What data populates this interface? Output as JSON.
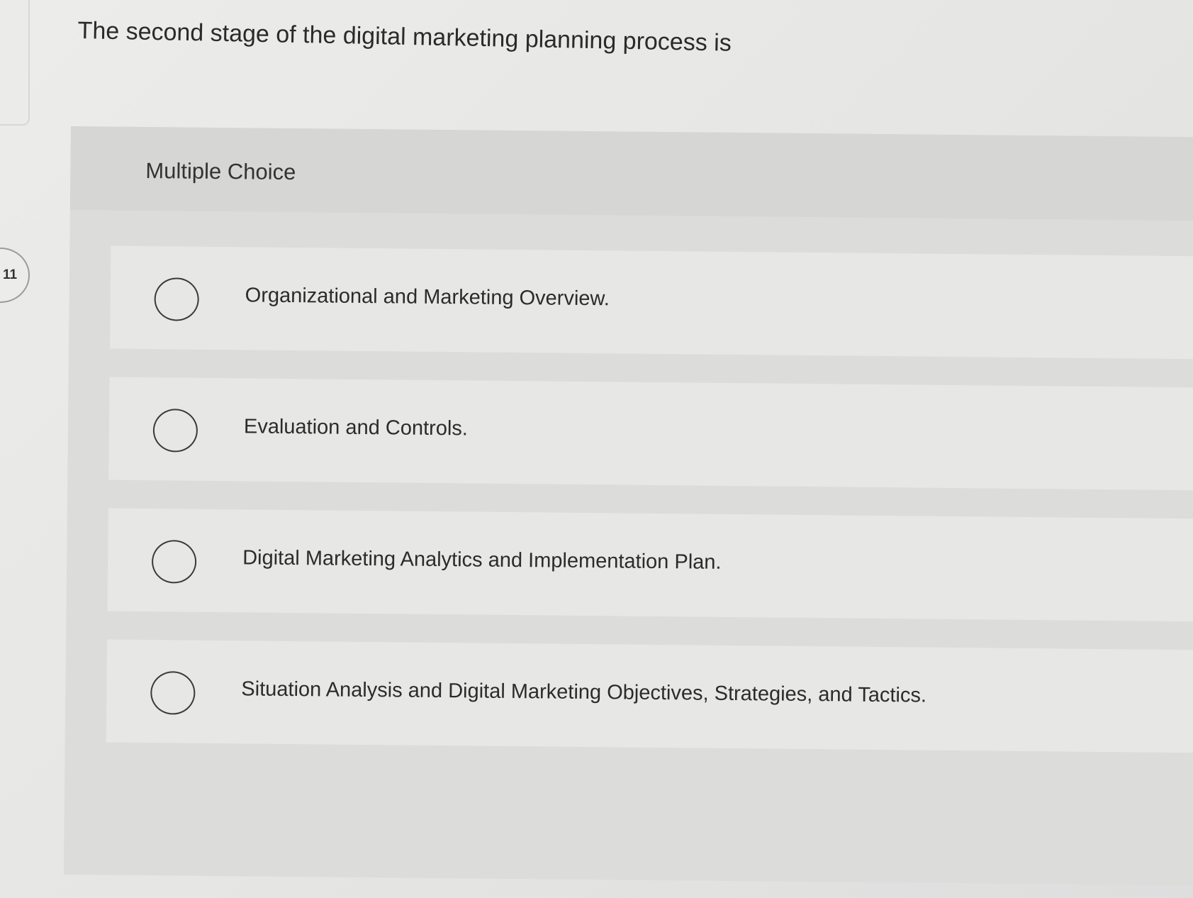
{
  "question": {
    "number": "11",
    "text": "The second stage of the digital marketing planning process is"
  },
  "multiple_choice": {
    "label": "Multiple Choice",
    "options": [
      {
        "label": "Organizational and Marketing Overview.",
        "selected": false
      },
      {
        "label": "Evaluation and Controls.",
        "selected": false
      },
      {
        "label": "Digital Marketing Analytics and Implementation Plan.",
        "selected": false
      },
      {
        "label": "Situation Analysis and Digital Marketing Objectives, Strategies, and Tactics.",
        "selected": false
      }
    ]
  }
}
